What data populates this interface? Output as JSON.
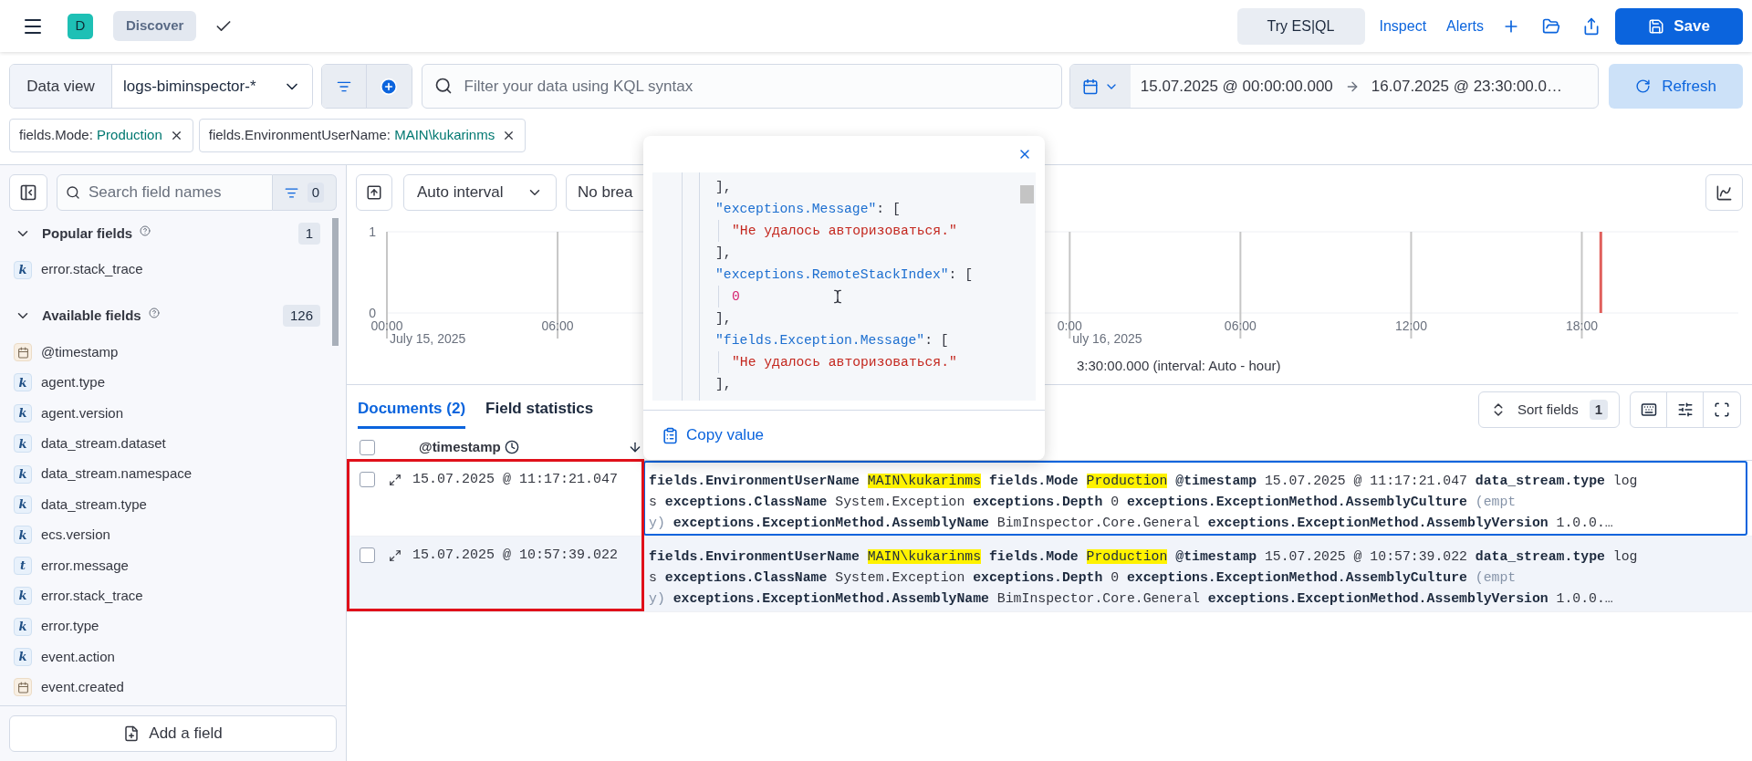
{
  "header": {
    "avatar": "D",
    "app_badge": "Discover",
    "esql_button": "Try ES|QL",
    "links": [
      "Inspect",
      "Alerts"
    ],
    "save_button": "Save"
  },
  "query_bar": {
    "data_view_label": "Data view",
    "data_view": "logs-biminspector-*",
    "search_placeholder": "Filter your data using KQL syntax",
    "time_start": "15.07.2025 @ 00:00:00.000",
    "time_end": "16.07.2025 @ 23:30:00.0…",
    "refresh": "Refresh"
  },
  "filters": [
    {
      "field": "fields.Mode:",
      "value": "Production"
    },
    {
      "field": "fields.EnvironmentUserName:",
      "value": "MAIN\\kukarinms"
    }
  ],
  "sidebar": {
    "search_placeholder": "Search field names",
    "filter_count": "0",
    "sections": [
      {
        "title": "Popular fields",
        "count": "1",
        "expanded": true,
        "fields": [
          {
            "kind": "letter",
            "badge": "k",
            "name": "error.stack_trace"
          }
        ]
      },
      {
        "title": "Available fields",
        "count": "126",
        "expanded": true,
        "fields": [
          {
            "kind": "date",
            "name": "@timestamp"
          },
          {
            "kind": "letter",
            "badge": "k",
            "name": "agent.type"
          },
          {
            "kind": "letter",
            "badge": "k",
            "name": "agent.version"
          },
          {
            "kind": "letter",
            "badge": "k",
            "name": "data_stream.dataset"
          },
          {
            "kind": "letter",
            "badge": "k",
            "name": "data_stream.namespace"
          },
          {
            "kind": "letter",
            "badge": "k",
            "name": "data_stream.type"
          },
          {
            "kind": "letter",
            "badge": "k",
            "name": "ecs.version"
          },
          {
            "kind": "letter",
            "badge": "t",
            "name": "error.message"
          },
          {
            "kind": "letter",
            "badge": "k",
            "name": "error.stack_trace"
          },
          {
            "kind": "letter",
            "badge": "k",
            "name": "error.type"
          },
          {
            "kind": "letter",
            "badge": "k",
            "name": "event.action"
          },
          {
            "kind": "date",
            "name": "event.created"
          }
        ]
      }
    ],
    "add_field": "Add a field"
  },
  "chart_panel": {
    "interval": "Auto interval",
    "breakdown": "No brea",
    "chart_data": {
      "type": "bar",
      "grid": true,
      "x": [
        "2025-07-16T18:40:00"
      ],
      "series": [
        {
          "color": "#e0605c",
          "values": [
            1
          ]
        }
      ],
      "xlim": [
        "2025-07-15T00:00:00",
        "2025-07-16T23:30:00"
      ],
      "ylim": [
        0,
        1
      ],
      "yticks": [
        0,
        1
      ],
      "xticks": [
        {
          "value": "2025-07-15T00:00:00",
          "label": "00:00"
        },
        {
          "value": "2025-07-15T06:00:00",
          "label": "06:00"
        },
        {
          "value": "2025-07-16T00:00:00",
          "label": "0:00"
        },
        {
          "value": "2025-07-16T06:00:00",
          "label": "06:00"
        },
        {
          "value": "2025-07-16T12:00:00",
          "label": "12:00"
        },
        {
          "value": "2025-07-16T18:00:00",
          "label": "18:00"
        }
      ]
    },
    "date_labels": [
      "July 15, 2025",
      "uly 16, 2025"
    ],
    "interval_note": "3:30:00.000 (interval: Auto - hour)"
  },
  "tabs": [
    {
      "label": "Documents (2)",
      "selected": true
    },
    {
      "label": "Field statistics",
      "selected": false
    }
  ],
  "sort_fields": {
    "label": "Sort fields",
    "count": "1"
  },
  "table": {
    "column": "@timestamp",
    "all_checked": false,
    "rows": [
      {
        "checked": false,
        "focused": true,
        "hovered": false,
        "timestamp": "15.07.2025 @ 11:17:21.047",
        "summary": [
          [
            {
              "kind": "key",
              "text": "fields.EnvironmentUserName"
            },
            {
              "kind": "mark",
              "text": "MAIN\\kukarinms"
            },
            {
              "kind": "key",
              "text": "fields.Mode"
            },
            {
              "kind": "mark",
              "text": "Production"
            },
            {
              "kind": "key",
              "text": "@timestamp"
            },
            {
              "kind": "value",
              "text": "15.07.2025 @ 11:17:21.047"
            },
            {
              "kind": "key",
              "text": "data_stream.type"
            },
            {
              "kind": "value",
              "text": "log"
            }
          ],
          [
            {
              "kind": "value",
              "text": "s"
            },
            {
              "kind": "key",
              "text": "exceptions.ClassName"
            },
            {
              "kind": "value",
              "text": "System.Exception"
            },
            {
              "kind": "key",
              "text": "exceptions.Depth"
            },
            {
              "kind": "value",
              "text": "0"
            },
            {
              "kind": "key",
              "text": "exceptions.ExceptionMethod.AssemblyCulture"
            },
            {
              "kind": "muted",
              "text": "(empt"
            }
          ],
          [
            {
              "kind": "muted",
              "text": "y)"
            },
            {
              "kind": "key",
              "text": "exceptions.ExceptionMethod.AssemblyName"
            },
            {
              "kind": "value",
              "text": "BimInspector.Core.General"
            },
            {
              "kind": "key",
              "text": "exceptions.ExceptionMethod.AssemblyVersion"
            },
            {
              "kind": "value",
              "text": "1.0.0.…"
            }
          ]
        ]
      },
      {
        "checked": false,
        "focused": false,
        "hovered": true,
        "timestamp": "15.07.2025 @ 10:57:39.022",
        "summary": [
          [
            {
              "kind": "key",
              "text": "fields.EnvironmentUserName"
            },
            {
              "kind": "mark",
              "text": "MAIN\\kukarinms"
            },
            {
              "kind": "key",
              "text": "fields.Mode"
            },
            {
              "kind": "mark",
              "text": "Production"
            },
            {
              "kind": "key",
              "text": "@timestamp"
            },
            {
              "kind": "value",
              "text": "15.07.2025 @ 10:57:39.022"
            },
            {
              "kind": "key",
              "text": "data_stream.type"
            },
            {
              "kind": "value",
              "text": "log"
            }
          ],
          [
            {
              "kind": "value",
              "text": "s"
            },
            {
              "kind": "key",
              "text": "exceptions.ClassName"
            },
            {
              "kind": "value",
              "text": "System.Exception"
            },
            {
              "kind": "key",
              "text": "exceptions.Depth"
            },
            {
              "kind": "value",
              "text": "0"
            },
            {
              "kind": "key",
              "text": "exceptions.ExceptionMethod.AssemblyCulture"
            },
            {
              "kind": "muted",
              "text": "(empt"
            }
          ],
          [
            {
              "kind": "muted",
              "text": "y)"
            },
            {
              "kind": "key",
              "text": "exceptions.ExceptionMethod.AssemblyName"
            },
            {
              "kind": "value",
              "text": "BimInspector.Core.General"
            },
            {
              "kind": "key",
              "text": "exceptions.ExceptionMethod.AssemblyVersion"
            },
            {
              "kind": "value",
              "text": "1.0.0.…"
            }
          ]
        ]
      }
    ]
  },
  "popover": {
    "leading": "],",
    "entries": [
      {
        "key": "\"exceptions.Message\"",
        "open": ": [",
        "values": [
          {
            "kind": "string",
            "text": "\"Не удалось авторизоваться.\""
          }
        ],
        "close": "],"
      },
      {
        "key": "\"exceptions.RemoteStackIndex\"",
        "open": ": [",
        "values": [
          {
            "kind": "number",
            "text": "0"
          }
        ],
        "close": "],"
      },
      {
        "key": "\"fields.Exception.Message\"",
        "open": ": [",
        "values": [
          {
            "kind": "string",
            "text": "\"Не удалось авторизоваться.\""
          }
        ],
        "close": "],"
      }
    ],
    "copy": "Copy value"
  }
}
